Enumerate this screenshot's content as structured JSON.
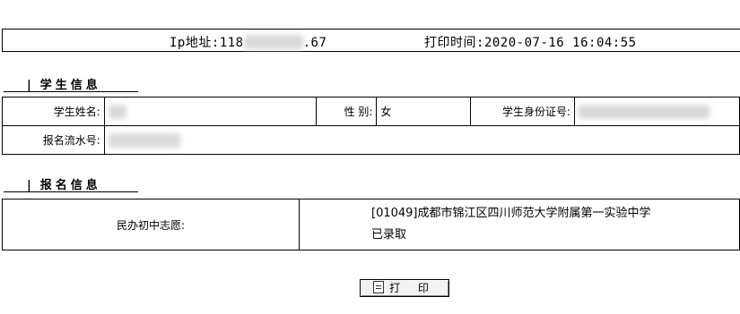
{
  "header": {
    "ip_label": "Ip地址:",
    "ip_prefix": "118",
    "ip_suffix": ".67",
    "print_time_label": "打印时间:",
    "print_time_value": "2020-07-16 16:04:55"
  },
  "student_section": {
    "marker": "|",
    "title": "学生信息",
    "name_label": "学生姓名:",
    "gender_label": "性 别:",
    "gender_value": "女",
    "id_label": "学生身份证号:",
    "serial_label": "报名流水号:"
  },
  "registration_section": {
    "marker": "|",
    "title": "报名信息",
    "choice_label": "民办初中志愿:",
    "school": "[01049]成都市锦江区四川师范大学附属第一实验中学",
    "status": "已录取"
  },
  "actions": {
    "print_label": "打 印",
    "print_icon": "document-icon"
  },
  "colors": {
    "background": "#ffffff",
    "border": "#000000",
    "redaction": "#d9d9d9",
    "button_bg": "#f2f2f2"
  }
}
